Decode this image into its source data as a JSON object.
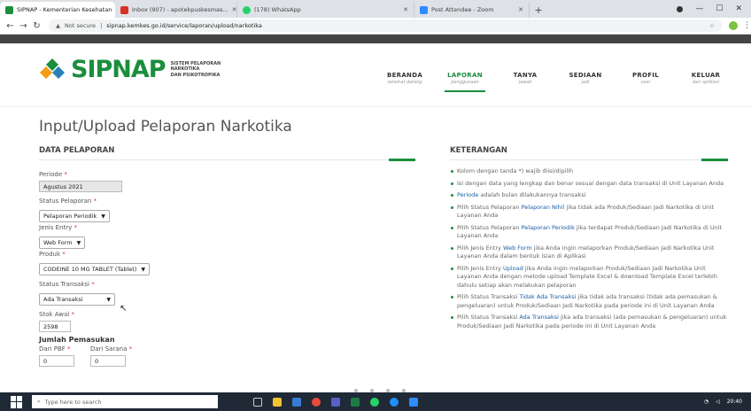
{
  "browser": {
    "tabs": [
      {
        "title": "SIPNAP - Kementerian Kesehatan",
        "color": "#1b8e3d"
      },
      {
        "title": "Inbox (907) - apotekpuskesmas...",
        "color": "#d93025"
      },
      {
        "title": "(178) WhatsApp",
        "color": "#25d366"
      },
      {
        "title": "Post Attendee - Zoom",
        "color": "#2d8cff"
      }
    ],
    "new_tab": "+",
    "security": "Not secure",
    "url": "sipnap.kemkes.go.id/service/laporan/upload/narkotika"
  },
  "site": {
    "logo_text": "SIPNAP",
    "logo_sub": [
      "SISTEM PELAPORAN",
      "NARKOTIKA",
      "DAN PSIKOTROPIKA"
    ],
    "nav": [
      {
        "title": "BERANDA",
        "sub": "selamat datang"
      },
      {
        "title": "LAPORAN",
        "sub": "penggunaan"
      },
      {
        "title": "TANYA",
        "sub": "jawab"
      },
      {
        "title": "SEDIAAN",
        "sub": "jadi"
      },
      {
        "title": "PROFIL",
        "sub": "user"
      },
      {
        "title": "KELUAR",
        "sub": "dari aplikasi"
      }
    ]
  },
  "page": {
    "title": "Input/Upload Pelaporan Narkotika",
    "left_section": "DATA PELAPORAN",
    "right_section": "KETERANGAN"
  },
  "form": {
    "periode_label": "Periode",
    "periode_value": "Agustus 2021",
    "status_pelaporan_label": "Status Pelaporan",
    "status_pelaporan_value": "Pelaporan Periodik",
    "jenis_entry_label": "Jenis Entry",
    "jenis_entry_value": "Web Form",
    "produk_label": "Produk",
    "produk_value": "CODEINE 10 MG TABLET (Tablet)",
    "status_transaksi_label": "Status Transaksi",
    "status_transaksi_value": "Ada Transaksi",
    "stok_awal_label": "Stok Awal",
    "stok_awal_value": "2598",
    "jumlah_pemasukan_label": "Jumlah Pemasukan",
    "dari_pbf_label": "Dari PBF",
    "dari_pbf_value": "0",
    "dari_sarana_label": "Dari Sarana",
    "dari_sarana_value": "0",
    "required_mark": "*"
  },
  "notes": [
    {
      "pre": "Kolom dengan tanda *) wajib diisi/dipilih",
      "hl": "",
      "post": ""
    },
    {
      "pre": "Isi dengan data yang lengkap dan benar sesuai dengan data transaksi di Unit Layanan Anda",
      "hl": "",
      "post": ""
    },
    {
      "pre": "",
      "hl": "Periode",
      "post": " adalah bulan dilakukannya transaksi"
    },
    {
      "pre": "Pilih Status Pelaporan ",
      "hl": "Pelaporan Nihil",
      "post": " jika tidak ada Produk/Sediaan Jadi Narkotika di Unit Layanan Anda"
    },
    {
      "pre": "Pilih Status Pelaporan ",
      "hl": "Pelaporan Periodik",
      "post": " jika terdapat Produk/Sediaan Jadi Narkotika di Unit Layanan Anda"
    },
    {
      "pre": "Pilih Jenis Entry ",
      "hl": "Web Form",
      "post": " jika Anda ingin melaporkan Produk/Sediaan Jadi Narkotika Unit Layanan Anda dalam bentuk isian di Aplikasi"
    },
    {
      "pre": "Pilih Jenis Entry ",
      "hl": "Upload",
      "post": " jika Anda ingin melaporkan Produk/Sediaan Jadi Narkotika Unit Layanan Anda dengan metode upload Template Excel & download Template Excel terlebih dahulu setiap akan melakukan pelaporan"
    },
    {
      "pre": "Pilih Status Transaksi ",
      "hl": "Tidak Ada Transaksi",
      "post": " jika tidak ada transaksi (tidak ada pemasukan & pengeluaran) untuk Produk/Sediaan Jadi Narkotika pada periode ini di Unit Layanan Anda"
    },
    {
      "pre": "Pilih Status Transaksi ",
      "hl": "Ada Transaksi",
      "post": " jika ada transaksi (ada pemasukan & pengeluaran) untuk Produk/Sediaan Jadi Narkotika pada periode ini di Unit Layanan Anda"
    }
  ],
  "taskbar": {
    "search_placeholder": "Type here to search",
    "time": "20:40"
  }
}
